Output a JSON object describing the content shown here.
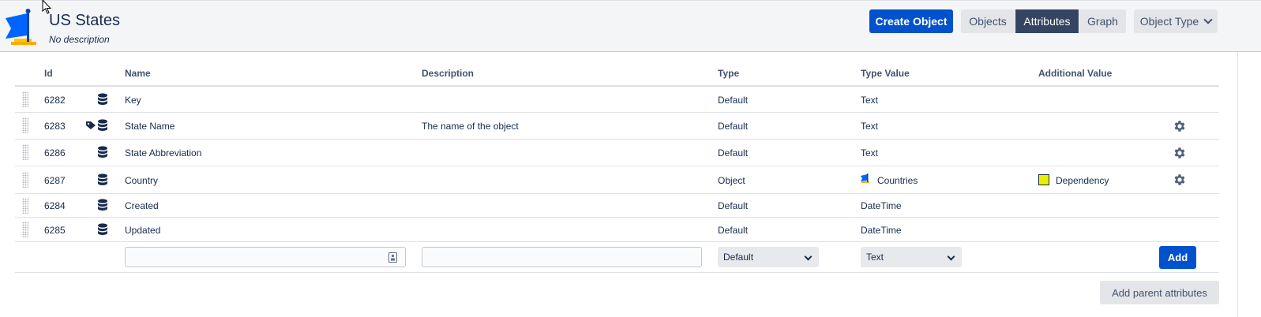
{
  "header": {
    "title": "US States",
    "subtitle": "No description",
    "create_label": "Create Object",
    "tabs": [
      "Objects",
      "Attributes",
      "Graph"
    ],
    "active_tab": "Attributes",
    "object_type_label": "Object Type"
  },
  "table": {
    "columns": {
      "id": "Id",
      "name": "Name",
      "description": "Description",
      "type": "Type",
      "type_value": "Type Value",
      "additional_value": "Additional Value"
    },
    "rows": [
      {
        "id": "6282",
        "name": "Key",
        "description": "",
        "type": "Default",
        "type_value": "Text",
        "additional": "",
        "icons": [
          "database-icon"
        ]
      },
      {
        "id": "6283",
        "name": "State Name",
        "description": "The name of the object",
        "type": "Default",
        "type_value": "Text",
        "additional": "",
        "icons": [
          "tag-icon",
          "database-icon"
        ]
      },
      {
        "id": "6286",
        "name": "State Abbreviation",
        "description": "",
        "type": "Default",
        "type_value": "Text",
        "additional": "",
        "icons": [
          "database-icon"
        ]
      },
      {
        "id": "6287",
        "name": "Country",
        "description": "",
        "type": "Object",
        "type_value": "Countries",
        "additional": "Dependency",
        "icons": [
          "database-icon"
        ]
      },
      {
        "id": "6284",
        "name": "Created",
        "description": "",
        "type": "Default",
        "type_value": "DateTime",
        "additional": "",
        "icons": [
          "database-icon"
        ]
      },
      {
        "id": "6285",
        "name": "Updated",
        "description": "",
        "type": "Default",
        "type_value": "DateTime",
        "additional": "",
        "icons": [
          "database-icon"
        ]
      }
    ]
  },
  "new_row": {
    "name_value": "",
    "description_value": "",
    "type_selected": "Default",
    "type_value_selected": "Text",
    "add_label": "Add"
  },
  "footer": {
    "add_parent_label": "Add parent attributes"
  },
  "colors": {
    "primary": "#0052cc",
    "active_tab": "#344563",
    "dependency_swatch": "#e8f000"
  }
}
